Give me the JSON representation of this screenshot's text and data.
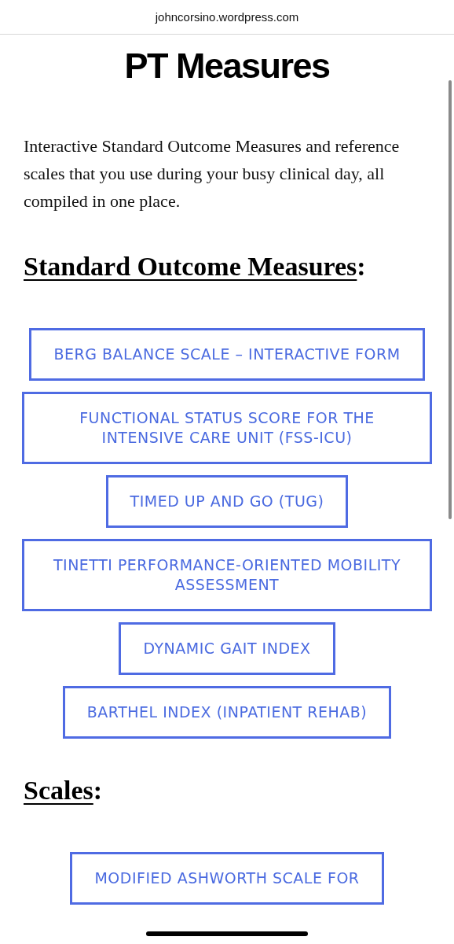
{
  "address_bar": {
    "url": "johncorsino.wordpress.com"
  },
  "site_title": "PT Measures",
  "intro": "Interactive Standard Outcome Measures and reference scales that you use during your busy clinical day, all compiled in one place.",
  "sections": [
    {
      "heading": "Standard Outcome Measures",
      "suffix": ":",
      "buttons": [
        "BERG BALANCE SCALE – INTERACTIVE FORM",
        "FUNCTIONAL STATUS SCORE FOR THE INTENSIVE CARE UNIT (FSS-ICU)",
        "TIMED UP AND GO (TUG)",
        "TINETTI PERFORMANCE-ORIENTED MOBILITY ASSESSMENT",
        "DYNAMIC GAIT INDEX",
        "BARTHEL INDEX (INPATIENT REHAB)"
      ]
    },
    {
      "heading": "Scales",
      "suffix": ":",
      "buttons": [
        "MODIFIED ASHWORTH SCALE FOR"
      ]
    }
  ]
}
